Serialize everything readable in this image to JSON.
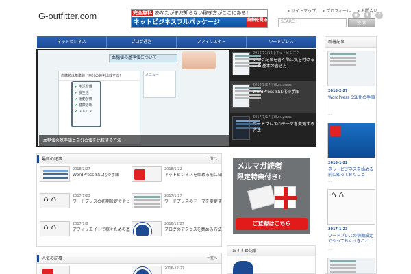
{
  "header": {
    "site_title": "G-outfitter.com",
    "banner": {
      "badge": "完全無料",
      "tagline": "あなたがまだ知らない稼ぎ方がここにある！",
      "main": "ネットビジネスフルパッケージ",
      "button": "詳細を見る"
    },
    "top_links": [
      "サイトマップ",
      "プロフィール",
      "お問合せ"
    ],
    "social_icons": [
      "rss-icon",
      "twitter-icon",
      "facebook-icon"
    ],
    "search": {
      "placeholder": "SEARCH",
      "button_label": "検 索"
    }
  },
  "nav": {
    "items": [
      "ネットビジネス",
      "ブログ運営",
      "アフィリエイト",
      "ワードプレス"
    ]
  },
  "slider": {
    "main": {
      "caption": "血糖値の基準値と自分の値を比較する方法",
      "image_title": "血糖値の基準値について",
      "card_heading": "血糖値は基準値と自分の値を比較する！",
      "checklist": [
        "生活習慣",
        "食生活",
        "運動習慣",
        "健康診断",
        "ストレス"
      ],
      "side_label": "メニュー"
    },
    "items": [
      {
        "meta": "2016/11/12 | ネットビジネス",
        "title": "ブログ記事を書く際に気を付けること 基本の書き方"
      },
      {
        "meta": "2018/2/27 | Wordpress",
        "title": "WordPress SSL化の手順"
      },
      {
        "meta": "2017/1/17 | Wordpress",
        "title": "ワードプレスのテーマを変更する方法"
      }
    ]
  },
  "recent": {
    "heading": "最新の記事",
    "more": "一覧へ",
    "posts": [
      {
        "date": "2018/2/27",
        "title": "WordPress SSL化の手順"
      },
      {
        "date": "2018/1/22",
        "title": "ネットビジネスを始める前に知っておくこと"
      },
      {
        "date": "2017/1/23",
        "title": "ワードプレスの初期設定でやっておくべきこと"
      },
      {
        "date": "2017/1/17",
        "title": "ワードプレスのテーマを変更する方法"
      },
      {
        "date": "2017/1/8",
        "title": "アフィリエイトで稼ぐための基本"
      },
      {
        "date": "2016/12/27",
        "title": "ブログのアクセスを集める方法とは"
      }
    ]
  },
  "popular": {
    "heading": "人気の記事",
    "more": "一覧へ",
    "first_date": "2016-12-27"
  },
  "mail_banner": {
    "line1": "メルマガ読者",
    "line2": "限定特典付き!",
    "cta": "ご登録はこちら"
  },
  "mid_widget": {
    "heading": "おすすめ記事"
  },
  "sidebar": {
    "heading": "新着記事",
    "items": [
      {
        "date": "2018-2-27",
        "title": "WordPress SSL化の手順"
      },
      {
        "date": "2018-1-22",
        "title": "ネットビジネスを始める前に知っておくこと"
      },
      {
        "date": "2017-1-23",
        "title": "ワードプレスの初期設定でやっておくべきこと"
      }
    ],
    "dots": "…"
  },
  "colors": {
    "nav_blue": "#1c4a93",
    "cta_red": "#e21a1a",
    "slider_bg": "#222222"
  }
}
